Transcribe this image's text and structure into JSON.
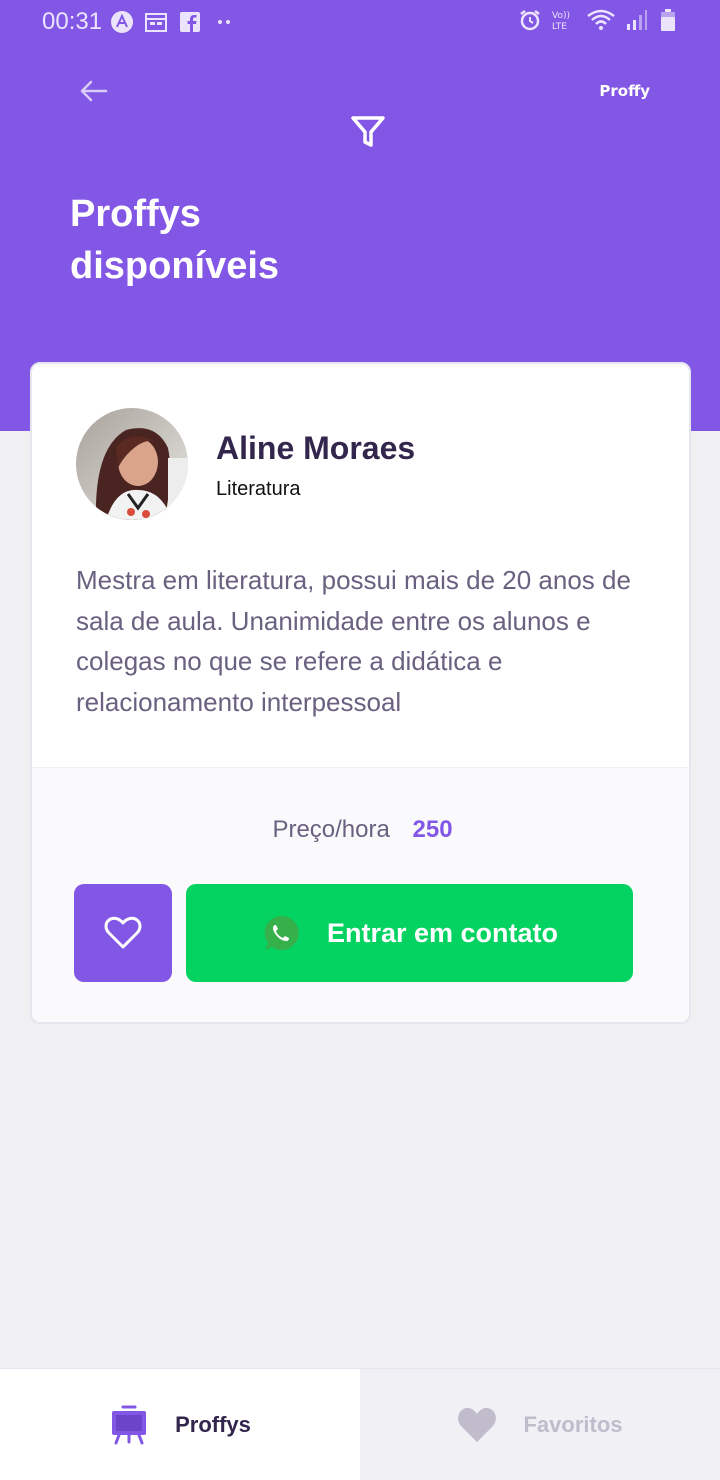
{
  "status_bar": {
    "time": "00:31",
    "left_icons": [
      "app-icon",
      "calendar-icon",
      "facebook-icon",
      "more-dots-icon"
    ],
    "right_icons": [
      "alarm-icon",
      "volte-icon",
      "wifi-icon",
      "signal-icon",
      "battery-icon"
    ],
    "volte_label": "Vo)) LTE"
  },
  "header": {
    "brand": "Proffy",
    "title": "Proffys disponíveis",
    "back_icon": "arrow-left-icon",
    "filter_icon": "filter-icon"
  },
  "teacher_card": {
    "name": "Aline Moraes",
    "subject": "Literatura",
    "bio": "Mestra em literatura, possui mais de 20 anos de sala de aula. Unanimidade entre os alunos e colegas no que se refere a didática e relacionamento interpessoal",
    "price_label": "Preço/hora",
    "price_value": "250",
    "favorite_icon": "heart-outline-icon",
    "contact_label": "Entrar em contato",
    "contact_icon": "whatsapp-icon"
  },
  "tabs": [
    {
      "label": "Proffys",
      "icon": "easel-icon",
      "active": true
    },
    {
      "label": "Favoritos",
      "icon": "heart-icon",
      "active": false
    }
  ],
  "colors": {
    "primary": "#8257e5",
    "success": "#04d361",
    "title": "#32264d",
    "text": "#6a6180",
    "background": "#f0f0f2"
  }
}
